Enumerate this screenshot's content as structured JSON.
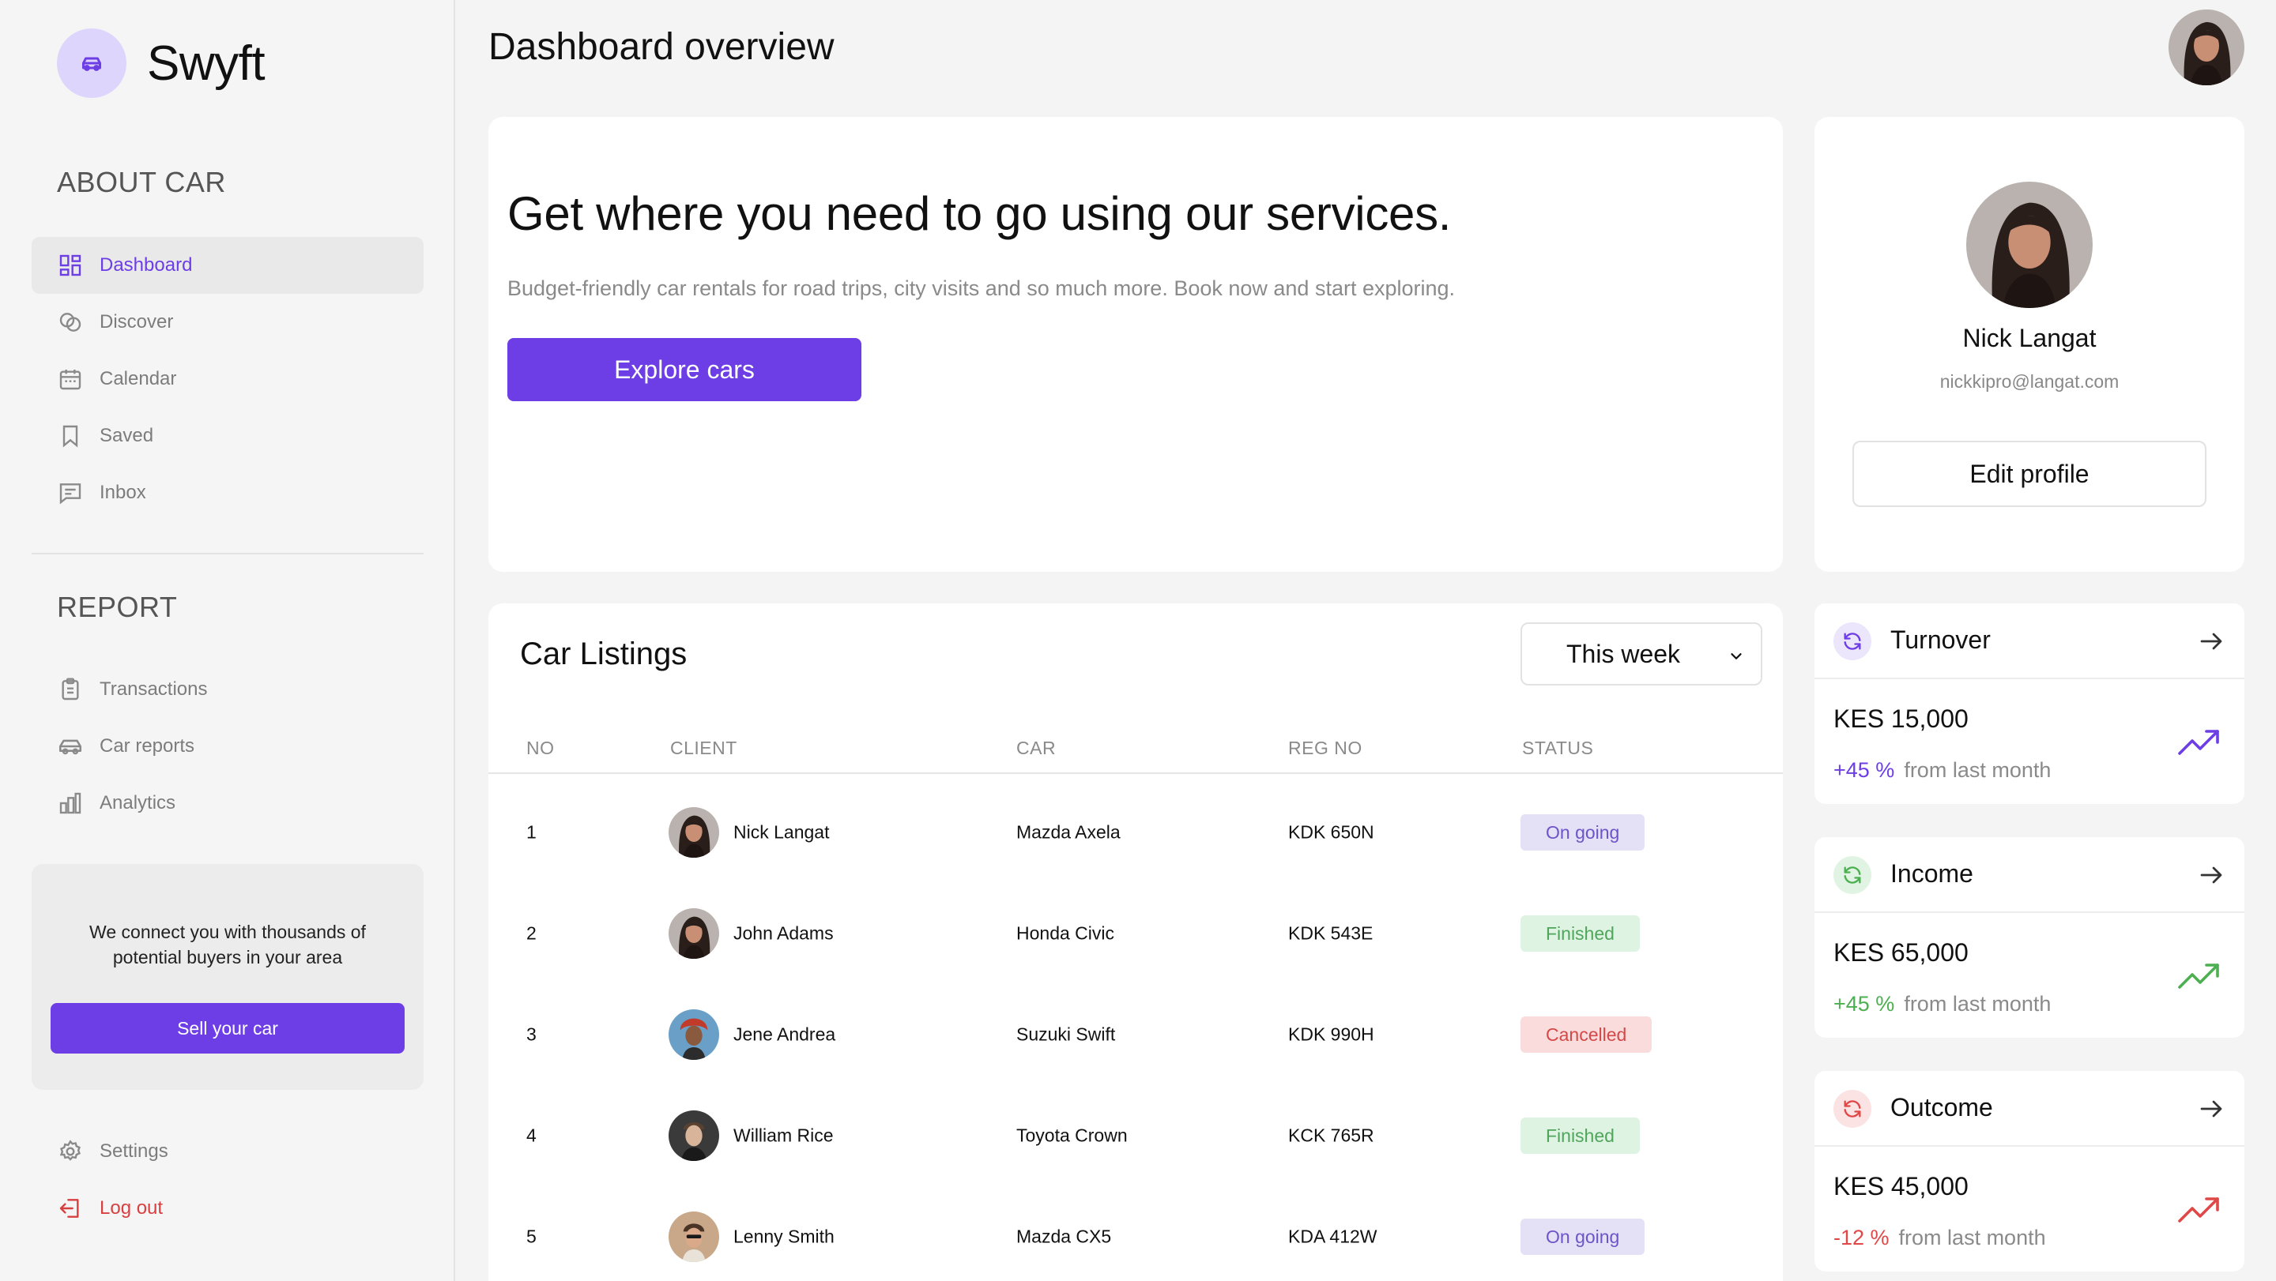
{
  "brand": {
    "name": "Swyft",
    "icon": "car-icon"
  },
  "sidebar": {
    "section_about": "ABOUT CAR",
    "nav_about": [
      {
        "label": "Dashboard",
        "icon": "dashboard-grid-icon",
        "active": true
      },
      {
        "label": "Discover",
        "icon": "discover-icon"
      },
      {
        "label": "Calendar",
        "icon": "calendar-icon"
      },
      {
        "label": "Saved",
        "icon": "bookmark-icon"
      },
      {
        "label": "Inbox",
        "icon": "chat-icon"
      }
    ],
    "section_report": "REPORT",
    "nav_report": [
      {
        "label": "Transactions",
        "icon": "clipboard-icon"
      },
      {
        "label": "Car reports",
        "icon": "car-icon"
      },
      {
        "label": "Analytics",
        "icon": "bar-chart-icon"
      }
    ],
    "promo": {
      "text": "We connect you with thousands of potential buyers in your area",
      "button": "Sell your car"
    },
    "settings": "Settings",
    "logout": "Log out"
  },
  "header": {
    "title": "Dashboard overview"
  },
  "hero": {
    "title": "Get where you need to go using our services.",
    "subtitle": "Budget-friendly car rentals for road trips, city visits and so much more. Book now and start exploring.",
    "button": "Explore cars"
  },
  "profile": {
    "name": "Nick Langat",
    "email": "nickkipro@langat.com",
    "button": "Edit profile"
  },
  "listings": {
    "title": "Car Listings",
    "filter": "This week",
    "columns": [
      "NO",
      "CLIENT",
      "CAR",
      "REG NO",
      "STATUS"
    ],
    "rows": [
      {
        "no": "1",
        "client": "Nick Langat",
        "car": "Mazda Axela",
        "reg": "KDK 650N",
        "status": "On going"
      },
      {
        "no": "2",
        "client": "John Adams",
        "car": "Honda Civic",
        "reg": "KDK 543E",
        "status": "Finished"
      },
      {
        "no": "3",
        "client": "Jene Andrea",
        "car": "Suzuki Swift",
        "reg": "KDK 990H",
        "status": "Cancelled"
      },
      {
        "no": "4",
        "client": "William Rice",
        "car": "Toyota Crown",
        "reg": "KCK 765R",
        "status": "Finished"
      },
      {
        "no": "5",
        "client": "Lenny Smith",
        "car": "Mazda CX5",
        "reg": "KDA 412W",
        "status": "On going"
      }
    ]
  },
  "stats": [
    {
      "label": "Turnover",
      "value": "KES 15,000",
      "change": "+45 %",
      "note": "from last month",
      "color": "#6d3de6"
    },
    {
      "label": "Income",
      "value": "KES 65,000",
      "change": "+45 %",
      "note": "from last month",
      "color": "#4caf50"
    },
    {
      "label": "Outcome",
      "value": "KES 45,000",
      "change": "-12 %",
      "note": "from last month",
      "color": "#e04848"
    }
  ]
}
